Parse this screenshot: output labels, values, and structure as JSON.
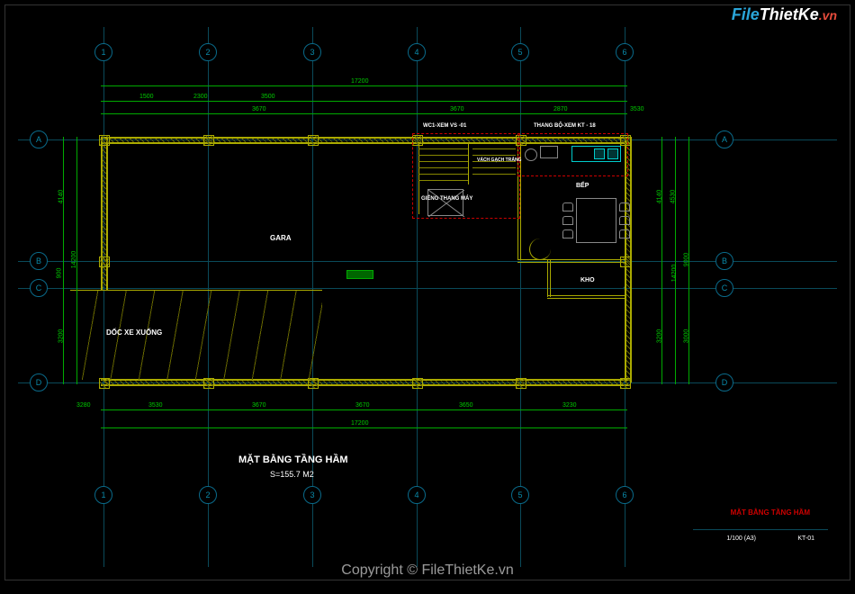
{
  "logo": {
    "p1": "File",
    "p2": "ThietKe",
    "p3": ".vn"
  },
  "watermark": "Copyright © FileThietKe.vn",
  "grid_vertical": [
    "1",
    "2",
    "3",
    "4",
    "5",
    "6"
  ],
  "grid_horizontal": [
    "A",
    "B",
    "C",
    "D"
  ],
  "rooms": {
    "gara": "GARA",
    "ramp": "DỐC XE XUỐNG",
    "bep": "BẾP",
    "kho": "KHO",
    "thang_may": "GIẾNG THANG MÁY",
    "wc_det1": "WC1-XEM VS -01",
    "wc_det2": "THANG BỘ-XEM KT - 18",
    "vach": "VÁCH GẠCH TRẮNG"
  },
  "title": {
    "main": "MẶT BẰNG TẦNG HẦM",
    "sub": "S=155.7 M2"
  },
  "dims_top_row1": [
    "1500",
    "2300",
    "3500",
    "3670",
    "2870",
    "3530"
  ],
  "dims_top_row2": [
    "3670",
    "17200"
  ],
  "dims_bottom_row1": [
    "3280",
    "3530",
    "3670",
    "3670",
    "3650",
    "3230"
  ],
  "dims_bottom_row2": [
    "17200"
  ],
  "dims_left": [
    "4140",
    "900",
    "14200",
    "3200"
  ],
  "dims_right": [
    "4140",
    "4530",
    "14200",
    "3200",
    "3000",
    "9000"
  ],
  "title_block": {
    "name": "MẶT BẰNG TẦNG HẦM",
    "scale": "1/100 (A3)",
    "sheet": "KT-01"
  }
}
